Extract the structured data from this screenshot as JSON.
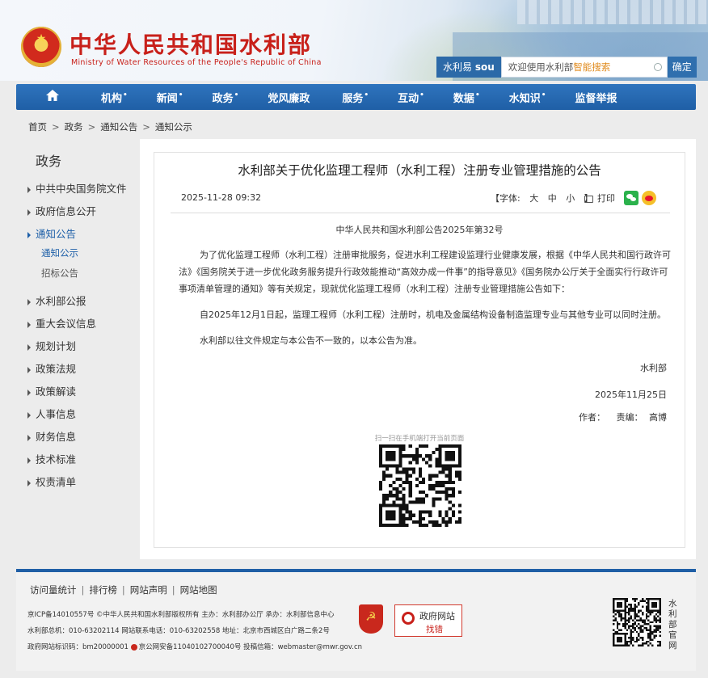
{
  "header": {
    "site_title": "中华人民共和国水利部",
    "site_subtitle": "Ministry of Water Resources of the People's Republic of China",
    "search": {
      "brand_prefix": "水利易",
      "brand_suffix": "sou",
      "placeholder_prefix": "欢迎使用水利部",
      "placeholder_highlight": "智能搜索",
      "submit_label": "确定"
    }
  },
  "nav": {
    "home_icon": "home-icon",
    "items": [
      {
        "label": "机构",
        "dot": "•"
      },
      {
        "label": "新闻",
        "dot": "•"
      },
      {
        "label": "政务",
        "dot": "•"
      },
      {
        "label": "党风廉政",
        "dot": ""
      },
      {
        "label": "服务",
        "dot": "•"
      },
      {
        "label": "互动",
        "dot": "•"
      },
      {
        "label": "数据",
        "dot": "•"
      },
      {
        "label": "水知识",
        "dot": "•"
      },
      {
        "label": "监督举报",
        "dot": ""
      }
    ]
  },
  "breadcrumb": [
    "首页",
    "政务",
    "通知公告",
    "通知公示"
  ],
  "breadcrumb_sep": ">",
  "sidebar": {
    "title": "政务",
    "items": [
      "中共中央国务院文件",
      "政府信息公开",
      "通知公告",
      "水利部公报",
      "重大会议信息",
      "规划计划",
      "政策法规",
      "政策解读",
      "人事信息",
      "财务信息",
      "技术标准",
      "权责清单"
    ],
    "subitems": [
      "通知公示",
      "招标公告"
    ]
  },
  "article": {
    "title": "水利部关于优化监理工程师（水利工程）注册专业管理措施的公告",
    "date": "2025-11-28 09:32",
    "font_label": "【字体:",
    "font_sizes": [
      "大",
      "中",
      "小"
    ],
    "font_close": "】",
    "print_label": "打印",
    "doc_number": "中华人民共和国水利部公告2025年第32号",
    "paragraphs": [
      "为了优化监理工程师（水利工程）注册审批服务，促进水利工程建设监理行业健康发展，根据《中华人民共和国行政许可法》《国务院关于进一步优化政务服务提升行政效能推动“高效办成一件事”的指导意见》《国务院办公厅关于全面实行行政许可事项清单管理的通知》等有关规定，现就优化监理工程师（水利工程）注册专业管理措施公告如下：",
      "自2025年12月1日起，监理工程师（水利工程）注册时，机电及金属结构设备制造监理专业与其他专业可以同时注册。",
      "水利部以往文件规定与本公告不一致的，以本公告为准。"
    ],
    "signer": "水利部",
    "sign_date": "2025年11月25日",
    "author_label": "作者：",
    "editor_label": "责编：",
    "editor_name": "高博",
    "qr_caption": "扫一扫在手机端打开当前页面"
  },
  "footer": {
    "links": [
      "访问量统计",
      "排行榜",
      "网站声明",
      "网站地图"
    ],
    "link_sep": "|",
    "line1": "京ICP备14010557号 ©中华人民共和国水利部版权所有 主办：水利部办公厅 承办：水利部信息中心",
    "line2": "水利部总机：010-63202114 网站联系电话：010-63202558 地址：北京市西城区白广路二条2号",
    "line3_prefix": "政府网站标识码：bm20000001",
    "line3_suffix": "京公网安备11040102700040号 投稿信箱：webmaster@mwr.gov.cn",
    "gov_badge_line1": "政府网站",
    "gov_badge_line2": "找错",
    "vertical_label": "水利部官网"
  }
}
